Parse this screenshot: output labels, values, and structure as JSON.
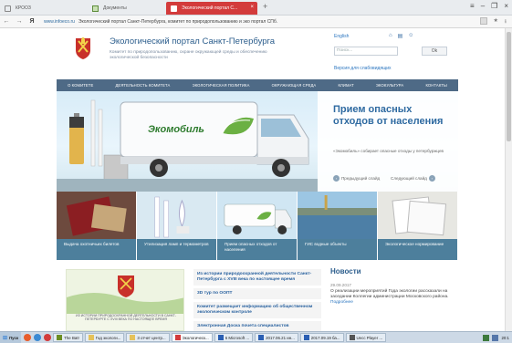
{
  "browser": {
    "tabs": [
      {
        "label": "КРООЗ"
      },
      {
        "label": "Документы"
      },
      {
        "label": "Экологический портал С...",
        "active": true
      }
    ],
    "new_tab": "+",
    "address": {
      "domain": "www.infoeco.ru",
      "page_title": "Экологический портал Санкт-Петербурга, комитет по природопользованию и эко портал СПб."
    },
    "yandex_button": "Я"
  },
  "site": {
    "title": "Экологический портал Санкт-Петербурга",
    "subtitle": "Комитет по природопользованию, охране окружающей среды и обеспечению экологической безопасности",
    "lang_link": "English",
    "search_placeholder": "Поиск...",
    "search_button": "Ok",
    "vision_link": "Версия для слабовидящих",
    "nav": [
      "О КОМИТЕТЕ",
      "ДЕЯТЕЛЬНОСТЬ КОМИТЕТА",
      "ЭКОЛОГИЧЕСКАЯ ПОЛИТИКА",
      "ОКРУЖАЮЩАЯ СРЕДА",
      "КЛИМАТ",
      "ЭКОКУЛЬТУРА",
      "КОНТАКТЫ"
    ],
    "banner": {
      "van_label": "Экомобиль",
      "title": "Прием опасных отходов от населения",
      "text": "«Экомобиль» собирает опасные отходы у петербуржцев",
      "prev": "Предыдущий слайд",
      "next": "Следующий слайд",
      "number": "12"
    },
    "tiles": [
      {
        "caption": "Выдача охотничьих билетов"
      },
      {
        "caption": "Утилизация ламп и термометров"
      },
      {
        "caption": "Прием опасных отходов от населения"
      },
      {
        "caption": "ГИС водные объекты"
      },
      {
        "caption": "Экологическое нормирование"
      }
    ],
    "poster_text": "ИЗ ИСТОРИИ ПРИРОДООХРАННОЙ ДЕЯТЕЛЬНОСТИ В САНКТ-ПЕТЕРБУРГЕ С XVIII ВЕКА ПО НАСТОЯЩЕЕ ВРЕМЯ",
    "links": [
      "Из истории природоохранной деятельности Санкт-Петербурга с XVIII века по настоящее время",
      "3D тур по ООПТ",
      "Комитет размещает информацию об общественном экологическом контроле",
      "Электронная Доска почета специалистов"
    ],
    "news": {
      "title": "Новости",
      "date": "29.09.2017",
      "text": "О реализации мероприятий Года экологии рассказали на заседании Коллегии администрации Московского района.",
      "more": "Подробнее",
      "date2": "29.09.2017"
    }
  },
  "taskbar": {
    "start": "Пуск",
    "tasks": [
      "The Bat!",
      "Год экологи...",
      "3 отчет центр...",
      "Экологическ...",
      "6 Microsoft ...",
      "2017.06.21 ин...",
      "2017.09.19 ба...",
      "Uecc Player ..."
    ],
    "clock": "20:1"
  },
  "colors": {
    "nav_bg": "#4e6a86",
    "tile_caption_bg": "#4d7f9c",
    "title_blue": "#2b5d8c",
    "active_tab": "#d33b3b"
  }
}
